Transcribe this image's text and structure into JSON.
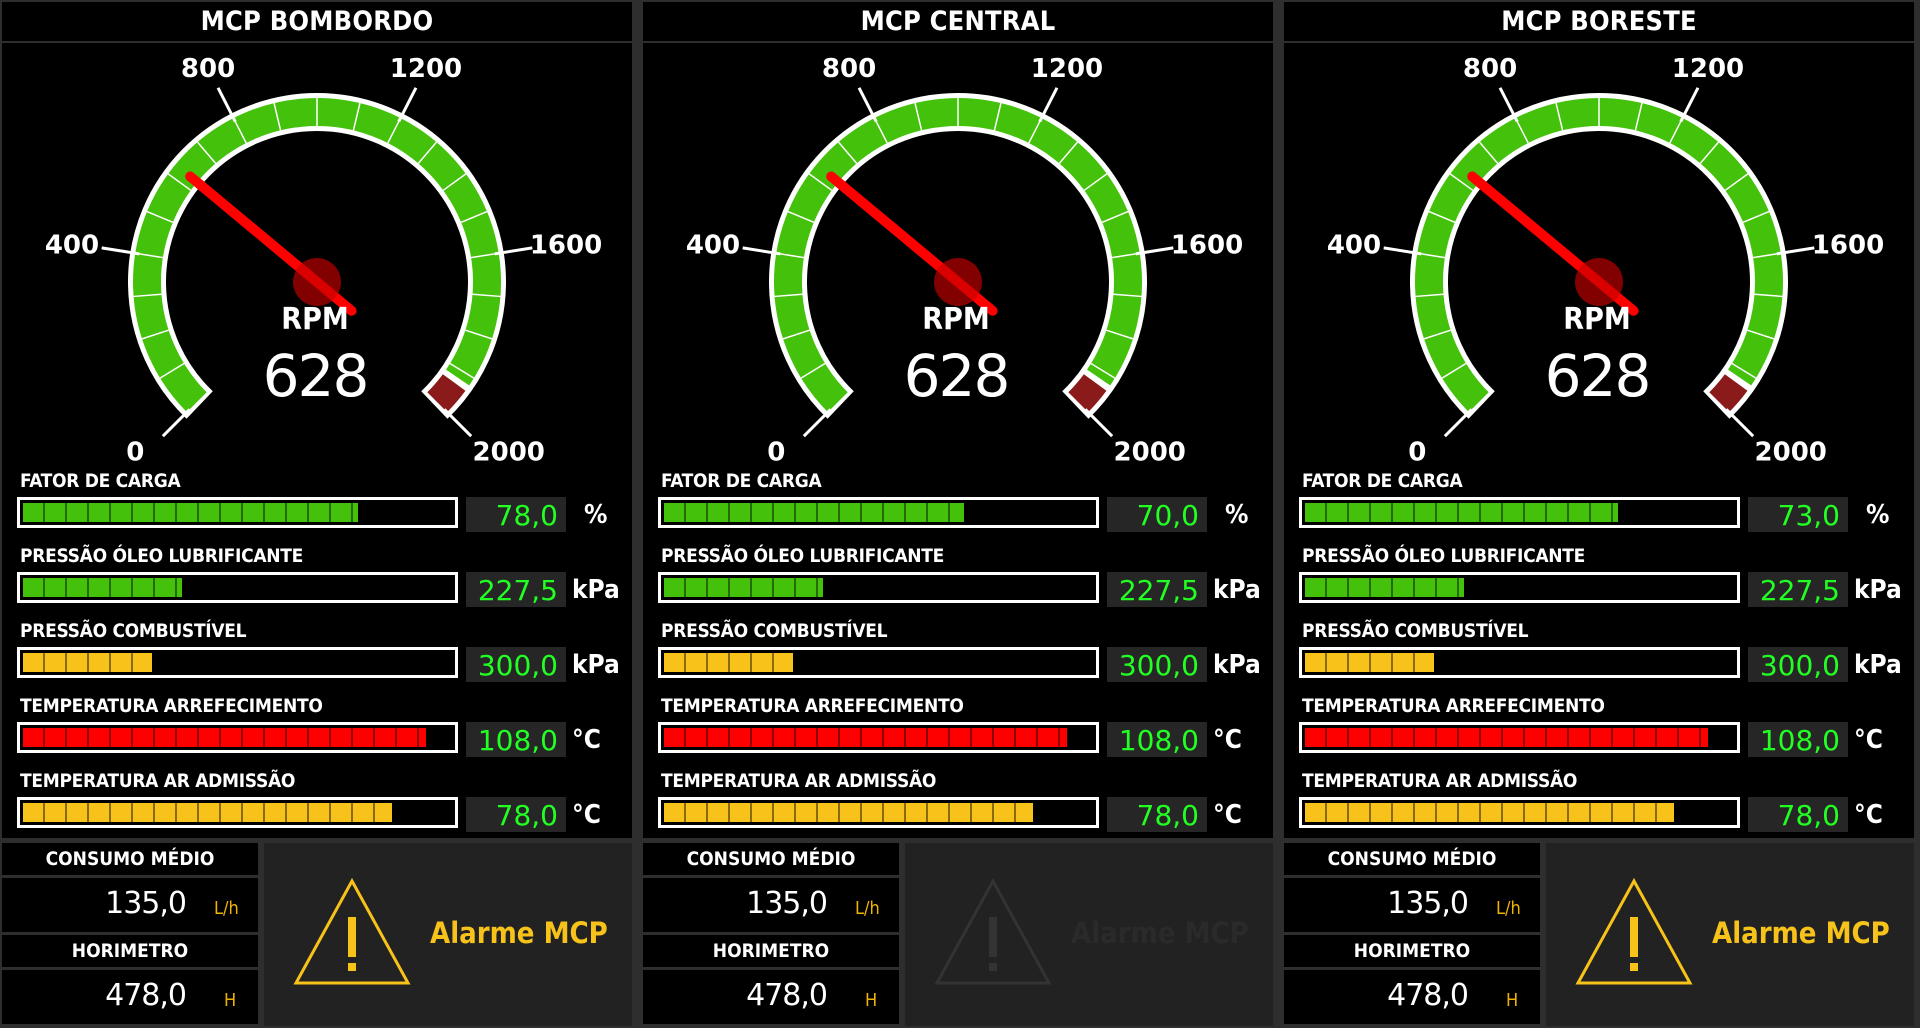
{
  "colors": {
    "green": "#44c10a",
    "yellow": "#f7c31b",
    "red": "#ff0000",
    "value_green": "#22ff22",
    "needle": "#ff0000",
    "redzone": "#8b1a1a"
  },
  "gauge_labels": [
    "0",
    "400",
    "800",
    "1200",
    "1600",
    "2000"
  ],
  "panels": [
    {
      "title": "MCP BOMBORDO",
      "rpm_label": "RPM",
      "rpm_value": "628",
      "rpm": 628,
      "metrics": [
        {
          "label": "FATOR DE CARGA",
          "value": "78,0",
          "unit": "%",
          "color": "#44c10a",
          "level": 0.78
        },
        {
          "label": "PRESSÃO ÓLEO LUBRIFICANTE",
          "value": "227,5",
          "unit": "kPa",
          "color": "#44c10a",
          "level": 0.37
        },
        {
          "label": "PRESSÃO COMBUSTÍVEL",
          "value": "300,0",
          "unit": "kPa",
          "color": "#f7c31b",
          "level": 0.3
        },
        {
          "label": "TEMPERATURA ARREFECIMENTO",
          "value": "108,0",
          "unit": "°C",
          "color": "#ff0000",
          "level": 0.94
        },
        {
          "label": "TEMPERATURA AR ADMISSÃO",
          "value": "78,0",
          "unit": "°C",
          "color": "#f7c31b",
          "level": 0.86
        }
      ],
      "consumo_title": "CONSUMO MÉDIO",
      "consumo_value": "135,0",
      "consumo_unit": "L/h",
      "horimetro_title": "HORIMETRO",
      "horimetro_value": "478,0",
      "horimetro_unit": "H",
      "alarm_text": "Alarme MCP",
      "alarm_active": true
    },
    {
      "title": "MCP CENTRAL",
      "rpm_label": "RPM",
      "rpm_value": "628",
      "rpm": 628,
      "metrics": [
        {
          "label": "FATOR DE CARGA",
          "value": "70,0",
          "unit": "%",
          "color": "#44c10a",
          "level": 0.7
        },
        {
          "label": "PRESSÃO ÓLEO LUBRIFICANTE",
          "value": "227,5",
          "unit": "kPa",
          "color": "#44c10a",
          "level": 0.37
        },
        {
          "label": "PRESSÃO COMBUSTÍVEL",
          "value": "300,0",
          "unit": "kPa",
          "color": "#f7c31b",
          "level": 0.3
        },
        {
          "label": "TEMPERATURA ARREFECIMENTO",
          "value": "108,0",
          "unit": "°C",
          "color": "#ff0000",
          "level": 0.94
        },
        {
          "label": "TEMPERATURA AR ADMISSÃO",
          "value": "78,0",
          "unit": "°C",
          "color": "#f7c31b",
          "level": 0.86
        }
      ],
      "consumo_title": "CONSUMO MÉDIO",
      "consumo_value": "135,0",
      "consumo_unit": "L/h",
      "horimetro_title": "HORIMETRO",
      "horimetro_value": "478,0",
      "horimetro_unit": "H",
      "alarm_text": "Alarme MCP",
      "alarm_active": false
    },
    {
      "title": "MCP BORESTE",
      "rpm_label": "RPM",
      "rpm_value": "628",
      "rpm": 628,
      "metrics": [
        {
          "label": "FATOR DE CARGA",
          "value": "73,0",
          "unit": "%",
          "color": "#44c10a",
          "level": 0.73
        },
        {
          "label": "PRESSÃO ÓLEO LUBRIFICANTE",
          "value": "227,5",
          "unit": "kPa",
          "color": "#44c10a",
          "level": 0.37
        },
        {
          "label": "PRESSÃO COMBUSTÍVEL",
          "value": "300,0",
          "unit": "kPa",
          "color": "#f7c31b",
          "level": 0.3
        },
        {
          "label": "TEMPERATURA ARREFECIMENTO",
          "value": "108,0",
          "unit": "°C",
          "color": "#ff0000",
          "level": 0.94
        },
        {
          "label": "TEMPERATURA AR ADMISSÃO",
          "value": "78,0",
          "unit": "°C",
          "color": "#f7c31b",
          "level": 0.86
        }
      ],
      "consumo_title": "CONSUMO MÉDIO",
      "consumo_value": "135,0",
      "consumo_unit": "L/h",
      "horimetro_title": "HORIMETRO",
      "horimetro_value": "478,0",
      "horimetro_unit": "H",
      "alarm_text": "Alarme MCP",
      "alarm_active": true
    }
  ]
}
